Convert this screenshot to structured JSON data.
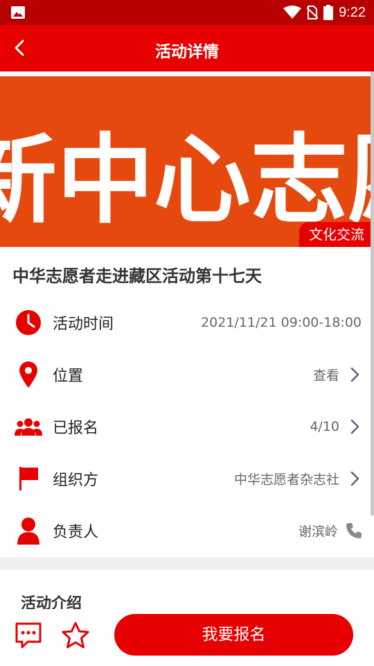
{
  "status_bar": {
    "time": "9:22"
  },
  "header": {
    "title": "活动详情"
  },
  "banner": {
    "image_text": "新中心志愿者",
    "category_tag": "文化交流"
  },
  "activity": {
    "title": "中华志愿者走进藏区活动第十七天"
  },
  "details": {
    "time": {
      "label": "活动时间",
      "value": "2021/11/21 09:00-18:00"
    },
    "location": {
      "label": "位置",
      "value": "查看"
    },
    "registered": {
      "label": "已报名",
      "value": "4/10"
    },
    "organizer": {
      "label": "组织方",
      "value": "中华志愿者杂志社"
    },
    "contact": {
      "label": "负责人",
      "value": "谢滨岭"
    }
  },
  "intro": {
    "section_title": "活动介绍"
  },
  "bottom": {
    "signup_label": "我要报名"
  },
  "colors": {
    "primary": "#e60000",
    "status_bar": "#b80000",
    "banner_bg": "#e5490d"
  },
  "icons": [
    "image-icon",
    "wifi-icon",
    "no-sim-icon",
    "battery-icon",
    "back-icon",
    "clock-icon",
    "location-pin-icon",
    "people-icon",
    "flag-icon",
    "person-icon",
    "chevron-right-icon",
    "phone-icon",
    "chat-icon",
    "star-icon"
  ]
}
